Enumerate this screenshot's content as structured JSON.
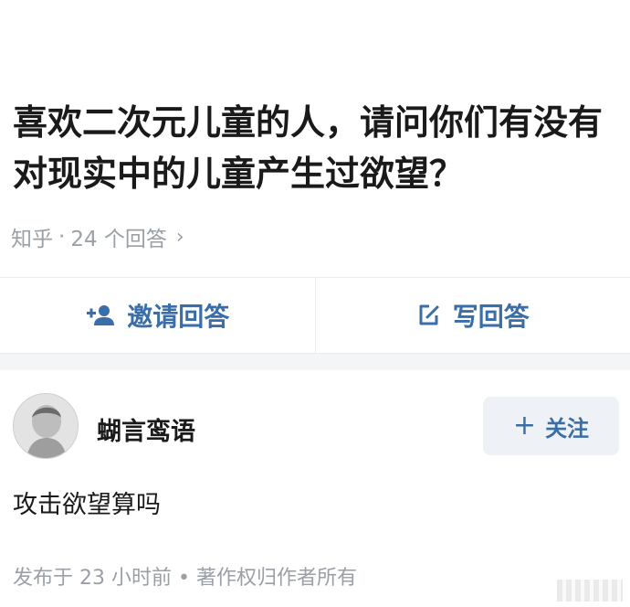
{
  "question": {
    "title": "喜欢二次元儿童的人，请问你们有没有对现实中的儿童产生过欲望？",
    "source": "知乎",
    "dot": "·",
    "answer_count": "24 个回答",
    "chevron": "›"
  },
  "actions": {
    "invite_label": "邀请回答",
    "invite_icon": "add-user-icon",
    "write_label": "写回答",
    "write_icon": "edit-icon"
  },
  "answer": {
    "author": "蝴言鸾语",
    "follow_label": "关注",
    "follow_plus": "+",
    "content": "攻击欲望算吗",
    "meta": "发布于 23 小时前 • 著作权归作者所有"
  },
  "colors": {
    "accent": "#3a6ea8",
    "muted": "#9aa0a6",
    "text": "#1a1a1a"
  }
}
